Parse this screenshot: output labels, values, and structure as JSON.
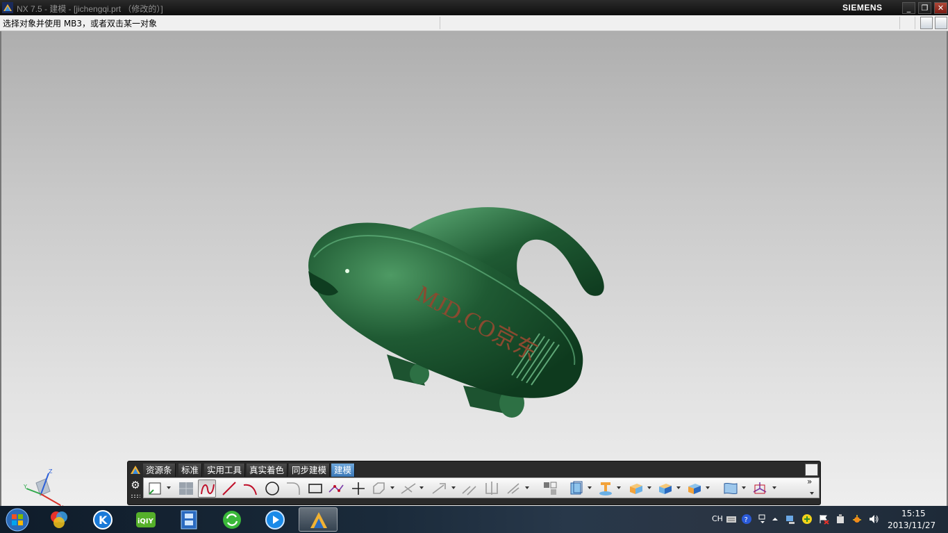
{
  "window": {
    "title": "NX 7.5 - 建模 - [jichengqi.prt （修改的）]",
    "brand": "SIEMENS",
    "buttons": [
      "minimize",
      "restore",
      "close"
    ]
  },
  "cue_line": {
    "prompt": "选择对象并使用 MB3，或者双击某一对象"
  },
  "model": {
    "engraved_text": "MJD.CO京东",
    "body_color": "#1f5a33",
    "highlight_color": "#4fa06a",
    "text_color": "#8a4a30"
  },
  "triad": {
    "axes": [
      "Z",
      "Y",
      "X"
    ]
  },
  "toolbar_dock": {
    "tabs": [
      {
        "label": "资源条",
        "active": false
      },
      {
        "label": "标准",
        "active": false
      },
      {
        "label": "实用工具",
        "active": false
      },
      {
        "label": "真实着色",
        "active": false
      },
      {
        "label": "同步建模",
        "active": false
      },
      {
        "label": "建模",
        "active": true
      }
    ],
    "icons": [
      "sketch-icon",
      "datum-plane-icon",
      "studio-spline-icon",
      "line-icon",
      "arc-icon",
      "circle-icon",
      "fillet-curve-icon",
      "rectangle-icon",
      "point-icon",
      "plus-icon",
      "polygon-icon",
      "trim-icon",
      "extend-icon",
      "offset-icon",
      "mirror-icon",
      "pattern-icon",
      "extrude-icon",
      "revolve-icon",
      "block-icon",
      "edge-blend-icon",
      "shell-icon",
      "through-curves-icon",
      "datum-csys-icon"
    ],
    "overflow": "»"
  },
  "taskbar": {
    "apps": [
      "start-orb",
      "color-app",
      "kugou",
      "iqiyi",
      "film-strip",
      "refresh-green",
      "media-player",
      "nx-app"
    ],
    "tray": {
      "lang": "CH",
      "time": "15:15",
      "date": "2013/11/27"
    }
  }
}
